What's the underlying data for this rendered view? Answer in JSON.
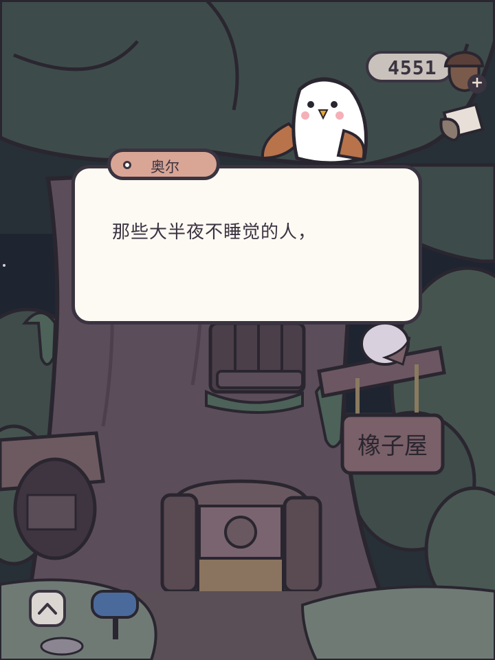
{
  "hud": {
    "currency_value": "4551",
    "currency_icon": "acorn-icon",
    "add_icon": "plus-icon",
    "shop_icon": "coupon-icon"
  },
  "dialog": {
    "speaker": "奥尔",
    "text": "那些大半夜不睡觉的人，"
  },
  "scene": {
    "sign_text": "橡子屋"
  },
  "controls": {
    "expand_icon": "chevron-up-icon"
  },
  "colors": {
    "dialog_bg": "#fdf9f3",
    "name_tag": "#d9a595",
    "outline": "#3a3340",
    "foliage": "#3e4b4b",
    "tree_trunk": "#5c4d5a"
  }
}
